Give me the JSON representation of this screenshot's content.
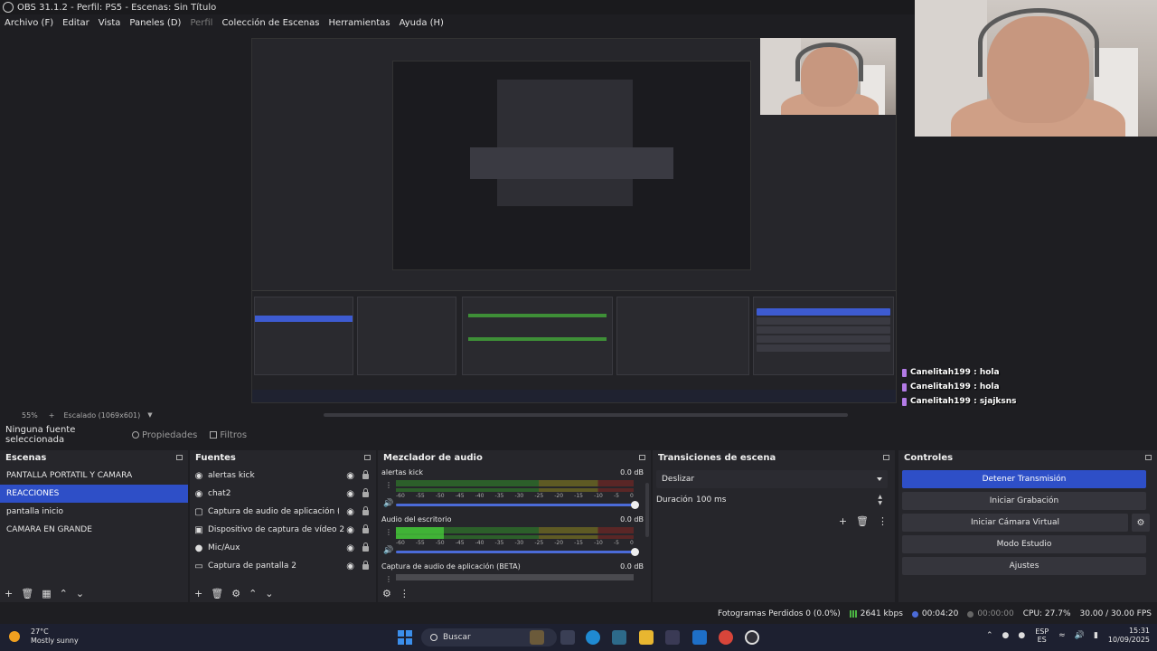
{
  "window": {
    "title": "OBS 31.1.2 - Perfil: PS5 - Escenas: Sin Título"
  },
  "menu": [
    {
      "label": "Archivo (F)",
      "disabled": false
    },
    {
      "label": "Editar",
      "disabled": false
    },
    {
      "label": "Vista",
      "disabled": false
    },
    {
      "label": "Paneles (D)",
      "disabled": false
    },
    {
      "label": "Perfil",
      "disabled": true
    },
    {
      "label": "Colección de Escenas",
      "disabled": false
    },
    {
      "label": "Herramientas",
      "disabled": false
    },
    {
      "label": "Ayuda (H)",
      "disabled": false
    }
  ],
  "chat": [
    {
      "user": "Canelitah199",
      "msg": "hola"
    },
    {
      "user": "Canelitah199",
      "msg": "hola"
    },
    {
      "user": "Canelitah199",
      "msg": "sjajksns"
    }
  ],
  "preview_status": {
    "zoom": "55%",
    "scale": "Escalado (1069x601)"
  },
  "toolbar": {
    "no_source": "Ninguna fuente seleccionada",
    "props": "Propiedades",
    "filters": "Filtros"
  },
  "scenes": {
    "title": "Escenas",
    "items": [
      "PANTALLA PORTATIL Y CAMARA",
      "REACCIONES",
      "pantalla inicio",
      "CAMARA EN GRANDE"
    ],
    "selected": 1
  },
  "sources": {
    "title": "Fuentes",
    "items": [
      {
        "label": "alertas kick",
        "icon": "browser-icon"
      },
      {
        "label": "chat2",
        "icon": "browser-icon"
      },
      {
        "label": "Captura de audio de aplicación (BETA)",
        "icon": "app-audio-icon"
      },
      {
        "label": "Dispositivo de captura de vídeo 2",
        "icon": "camera-icon"
      },
      {
        "label": "Mic/Aux",
        "icon": "mic-icon"
      },
      {
        "label": "Captura de pantalla 2",
        "icon": "monitor-icon"
      }
    ]
  },
  "mixer": {
    "title": "Mezclador de audio",
    "ticks": [
      "-60",
      "-55",
      "-50",
      "-45",
      "-40",
      "-35",
      "-30",
      "-25",
      "-20",
      "-15",
      "-10",
      "-5",
      "0"
    ],
    "channels": [
      {
        "name": "alertas kick",
        "db": "0.0 dB",
        "level": 0.0
      },
      {
        "name": "Audio del escritorio",
        "db": "0.0 dB",
        "level": 0.2
      },
      {
        "name": "Captura de audio de aplicación (BETA)",
        "db": "0.0 dB",
        "level": 0.0
      }
    ]
  },
  "transitions": {
    "title": "Transiciones de escena",
    "type": "Deslizar",
    "duration_label": "Duración",
    "duration": "100 ms"
  },
  "controls": {
    "title": "Controles",
    "buttons": [
      "Detener Transmisión",
      "Iniciar Grabación",
      "Iniciar Cámara Virtual",
      "Modo Estudio",
      "Ajustes"
    ]
  },
  "status": {
    "dropped": "Fotogramas Perdidos 0 (0.0%)",
    "bitrate": "2641 kbps",
    "stream_time": "00:04:20",
    "rec_time": "00:00:00",
    "cpu": "CPU: 27.7%",
    "fps": "30.00 / 30.00 FPS"
  },
  "taskbar": {
    "temp": "27°C",
    "weather": "Mostly sunny",
    "search": "Buscar",
    "lang1": "ESP",
    "lang2": "ES",
    "time": "15:31",
    "date": "10/09/2025"
  },
  "colors": {
    "accent": "#2e4fc7",
    "panel": "#26262b",
    "bg": "#1e1e22"
  }
}
